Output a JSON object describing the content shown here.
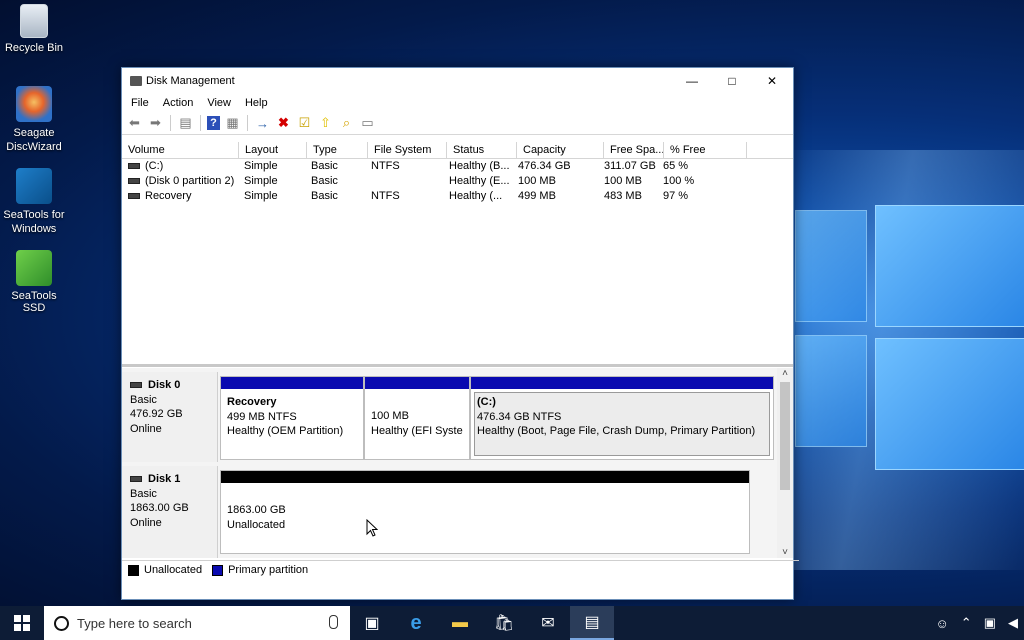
{
  "desktop": {
    "icons": [
      {
        "label": "Recycle Bin",
        "icon": "recycle-bin-icon"
      },
      {
        "label": "Seagate DiscWizard",
        "icon": "seagate-discwizard-icon"
      },
      {
        "label": "SeaTools for Windows",
        "icon": "seatools-icon"
      },
      {
        "label": "SeaTools SSD",
        "icon": "seatools-ssd-icon"
      }
    ]
  },
  "window": {
    "title": "Disk Management",
    "controls": {
      "minimize": "—",
      "maximize": "□",
      "close": "✕"
    },
    "menu": [
      "File",
      "Action",
      "View",
      "Help"
    ],
    "toolbar": [
      "back-icon",
      "forward-icon",
      "disk-view-icon",
      "help-icon",
      "properties-icon",
      "connect-icon",
      "delete-icon",
      "check-icon",
      "import-icon",
      "search-icon",
      "settings-icon"
    ],
    "columns": [
      "Volume",
      "Layout",
      "Type",
      "File System",
      "Status",
      "Capacity",
      "Free Spa...",
      "% Free"
    ],
    "volumes": [
      [
        "(C:)",
        "Simple",
        "Basic",
        "NTFS",
        "Healthy (B...",
        "476.34 GB",
        "311.07 GB",
        "65 %"
      ],
      [
        "(Disk 0 partition 2)",
        "Simple",
        "Basic",
        "",
        "Healthy (E...",
        "100 MB",
        "100 MB",
        "100 %"
      ],
      [
        "Recovery",
        "Simple",
        "Basic",
        "NTFS",
        "Healthy (...",
        "499 MB",
        "483 MB",
        "97 %"
      ]
    ],
    "disks": [
      {
        "name": "Disk 0",
        "type": "Basic",
        "size": "476.92 GB",
        "state": "Online",
        "partitions": [
          {
            "name": "Recovery",
            "size": "499 MB NTFS",
            "status": "Healthy (OEM Partition)"
          },
          {
            "name": "",
            "size": "100 MB",
            "status": "Healthy (EFI System"
          },
          {
            "name": "(C:)",
            "size": "476.34 GB NTFS",
            "status": "Healthy (Boot, Page File, Crash Dump, Primary Partition)"
          }
        ]
      },
      {
        "name": "Disk 1",
        "type": "Basic",
        "size": "1863.00 GB",
        "state": "Online",
        "partitions": [
          {
            "name": "",
            "size": "1863.00 GB",
            "status": "Unallocated"
          }
        ]
      }
    ],
    "legend": [
      {
        "label": "Unallocated",
        "color": "#000000"
      },
      {
        "label": "Primary partition",
        "color": "#0a0ab0"
      }
    ]
  },
  "taskbar": {
    "search_placeholder": "Type here to search",
    "apps": [
      "task-view-icon",
      "edge-icon",
      "file-explorer-icon",
      "store-icon",
      "mail-icon",
      "disk-management-icon"
    ]
  }
}
